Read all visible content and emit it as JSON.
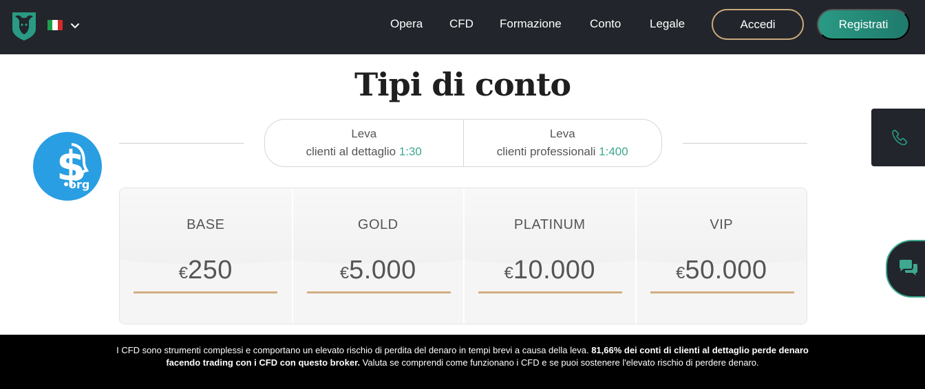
{
  "header": {
    "nav": [
      {
        "label": "Opera"
      },
      {
        "label": "CFD"
      },
      {
        "label": "Formazione"
      },
      {
        "label": "Conto"
      },
      {
        "label": "Legale"
      }
    ],
    "login_label": "Accedi",
    "register_label": "Registrati",
    "language": "Italiano",
    "brand_colors": {
      "accent": "#2a9a84",
      "gold": "#c9a97c",
      "bar": "#22252b"
    }
  },
  "main": {
    "title": "Tipi di conto",
    "leverage": [
      {
        "heading": "Leva",
        "label": "clienti al dettaglio",
        "ratio": "1:30"
      },
      {
        "heading": "Leva",
        "label": "clienti professionali",
        "ratio": "1:400"
      }
    ],
    "accounts": [
      {
        "name": "BASE",
        "currency": "€",
        "amount": "250"
      },
      {
        "name": "GOLD",
        "currency": "€",
        "amount": "5.000"
      },
      {
        "name": "PLATINUM",
        "currency": "€",
        "amount": "10.000"
      },
      {
        "name": "VIP",
        "currency": "€",
        "amount": "50.000"
      }
    ]
  },
  "badge": {
    "text": "org"
  },
  "risk": {
    "line1_normal": "I CFD sono strumenti complessi e comportano un elevato rischio di perdita del denaro in tempi brevi a causa della leva. ",
    "line1_bold": "81,66% dei conti di clienti al dettaglio perde denaro",
    "line2_bold": "facendo trading con i CFD con questo broker.",
    "line2_normal": " Valuta se comprendi come funzionano i CFD e se puoi sostenere l'elevato rischio di perdere denaro."
  }
}
